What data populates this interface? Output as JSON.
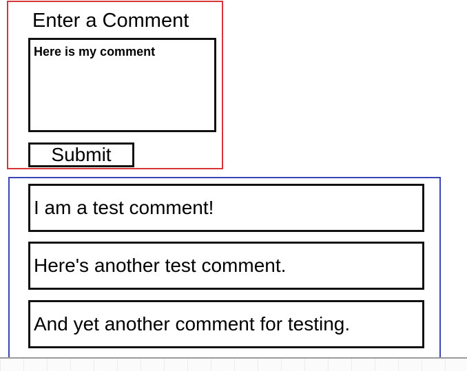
{
  "comment_form": {
    "title": "Enter a Comment",
    "input_value": "Here is my comment",
    "submit_label": "Submit"
  },
  "comment_list": {
    "items": [
      {
        "text": "I am a test comment!"
      },
      {
        "text": "Here's another test comment."
      },
      {
        "text": "And yet another comment for testing."
      }
    ]
  },
  "colors": {
    "form_border": "#d9343a",
    "list_border": "#3a44b5"
  }
}
